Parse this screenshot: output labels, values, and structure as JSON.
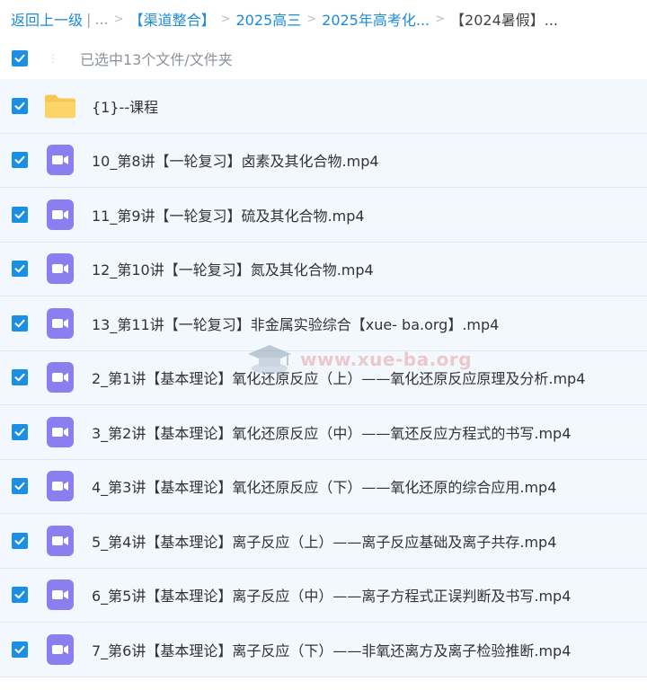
{
  "breadcrumb": {
    "back": "返回上一级",
    "divider": "|",
    "ellipsis": "...",
    "items": [
      "【渠道整合】",
      "2025高三",
      "2025年高考化...",
      "【2024暑假】..."
    ],
    "separator": ">"
  },
  "selection": {
    "text": "已选中13个文件/文件夹",
    "checked": true
  },
  "files": [
    {
      "name": "{1}--课程",
      "type": "folder",
      "checked": true
    },
    {
      "name": "10_第8讲【一轮复习】卤素及其化合物.mp4",
      "type": "video",
      "checked": true
    },
    {
      "name": "11_第9讲【一轮复习】硫及其化合物.mp4",
      "type": "video",
      "checked": true
    },
    {
      "name": "12_第10讲【一轮复习】氮及其化合物.mp4",
      "type": "video",
      "checked": true
    },
    {
      "name": "13_第11讲【一轮复习】非金属实验综合【xue- ba.org】.mp4",
      "type": "video",
      "checked": true
    },
    {
      "name": "2_第1讲【基本理论】氧化还原反应（上）——氧化还原反应原理及分析.mp4",
      "type": "video",
      "checked": true
    },
    {
      "name": "3_第2讲【基本理论】氧化还原反应（中）——氧还反应方程式的书写.mp4",
      "type": "video",
      "checked": true
    },
    {
      "name": "4_第3讲【基本理论】氧化还原反应（下）——氧化还原的综合应用.mp4",
      "type": "video",
      "checked": true
    },
    {
      "name": "5_第4讲【基本理论】离子反应（上）——离子反应基础及离子共存.mp4",
      "type": "video",
      "checked": true
    },
    {
      "name": "6_第5讲【基本理论】离子反应（中）——离子方程式正误判断及书写.mp4",
      "type": "video",
      "checked": true
    },
    {
      "name": "7_第6讲【基本理论】离子反应（下）——非氧还离方及离子检验推断.mp4",
      "type": "video",
      "checked": true
    }
  ],
  "watermark": {
    "text": "www.xue-ba.org"
  },
  "colors": {
    "link": "#1c8bd6",
    "checkbox": "#1a8fe3",
    "row_bg": "#f3f8fe",
    "folder": "#f9c74f",
    "video": "#8b7ff0"
  }
}
